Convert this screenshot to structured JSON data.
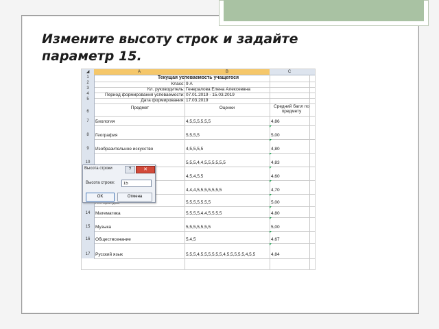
{
  "slide": {
    "title_line1": "Измените высоту строк и задайте",
    "title_line2": "параметр 15."
  },
  "colors": {
    "accent": "#a9c2a3",
    "header": "#dde4ee",
    "close": "#d24a3a",
    "mark": "#1a9c4a"
  },
  "sheet": {
    "columns": [
      "A",
      "B",
      "C"
    ],
    "rows": [
      {
        "num": "1",
        "a": "Текущая успеваемость учащегося",
        "b": "",
        "c": "",
        "bold": true
      },
      {
        "num": "2",
        "a": "Класс:",
        "b": "9 А",
        "c": ""
      },
      {
        "num": "3",
        "a": "Кл. руководитель:",
        "b": "Генералова Елена Алексеевна",
        "c": ""
      },
      {
        "num": "4",
        "a": "Период формирования успеваемости:",
        "b": "07.01.2019 - 15.03.2019",
        "c": ""
      },
      {
        "num": "5",
        "a": "Дата формирования:",
        "b": "17.03.2019",
        "c": ""
      },
      {
        "num": "6",
        "a": "Предмет",
        "b": "Оценки",
        "c": "Средний балл по предмету"
      },
      {
        "num": "7",
        "a": "Биология",
        "b": "4,5,5,5,5,5,5",
        "c": "4,86"
      },
      {
        "num": "8",
        "a": "География",
        "b": "5,5,5,5",
        "c": "5,00"
      },
      {
        "num": "9",
        "a": "Изобразительное искусство",
        "b": "4,5,5,5,5",
        "c": "4,80"
      },
      {
        "num": "10",
        "a": "",
        "b": "5,5,5,4,4,5,5,5,5,5,5",
        "c": "4,83"
      },
      {
        "num": "11",
        "a": "",
        "b": "4,5,4,5,5",
        "c": "4,60"
      },
      {
        "num": "12",
        "a": "",
        "b": "4,4,4,5,5,5,5,5,5,5",
        "c": "4,70"
      },
      {
        "num": "13",
        "a": "Литература",
        "b": "5,5,5,5,5,5,5",
        "c": "5,00"
      },
      {
        "num": "14",
        "a": "Математика",
        "b": "5,5,5,5,4,4,5,5,5,5",
        "c": "4,80"
      },
      {
        "num": "15",
        "a": "Музыка",
        "b": "5,5,5,5,5,5,5",
        "c": "5,00"
      },
      {
        "num": "16",
        "a": "Обществознание",
        "b": "5,4,5",
        "c": "4,67"
      },
      {
        "num": "17",
        "a": "Русский язык",
        "b": "5,5,5,4,5,5,5,5,5,5,4,5,5,5,5,5,4,5,5",
        "c": "4,84"
      }
    ]
  },
  "dialog": {
    "title": "Высота строки",
    "help": "?",
    "close": "✕",
    "label": "Высота строки:",
    "value": "15",
    "ok": "OK",
    "cancel": "Отмена"
  }
}
